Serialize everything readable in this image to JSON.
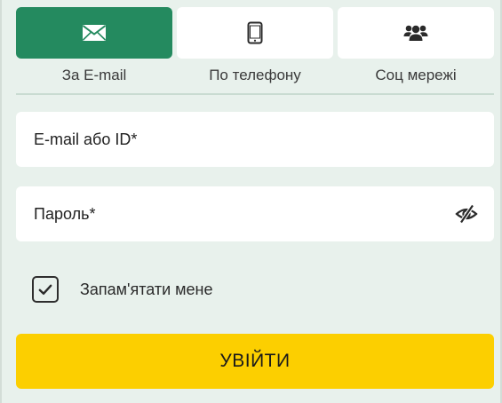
{
  "tabs": [
    {
      "label": "За E-mail",
      "icon": "envelope-icon",
      "active": true
    },
    {
      "label": "По телефону",
      "icon": "smartphone-icon",
      "active": false
    },
    {
      "label": "Соц мережі",
      "icon": "users-group-icon",
      "active": false
    }
  ],
  "email_field": {
    "placeholder": "E-mail або ID*",
    "value": ""
  },
  "password_field": {
    "placeholder": "Пароль*",
    "value": "",
    "toggle_icon": "eye-slash-icon"
  },
  "remember": {
    "label": "Запам'ятати мене",
    "checked": true
  },
  "login_button": {
    "label": "УВІЙТИ"
  },
  "colors": {
    "background": "#e8f1ec",
    "active_tab": "#248a5f",
    "primary_button": "#fccf00",
    "card": "#ffffff"
  }
}
